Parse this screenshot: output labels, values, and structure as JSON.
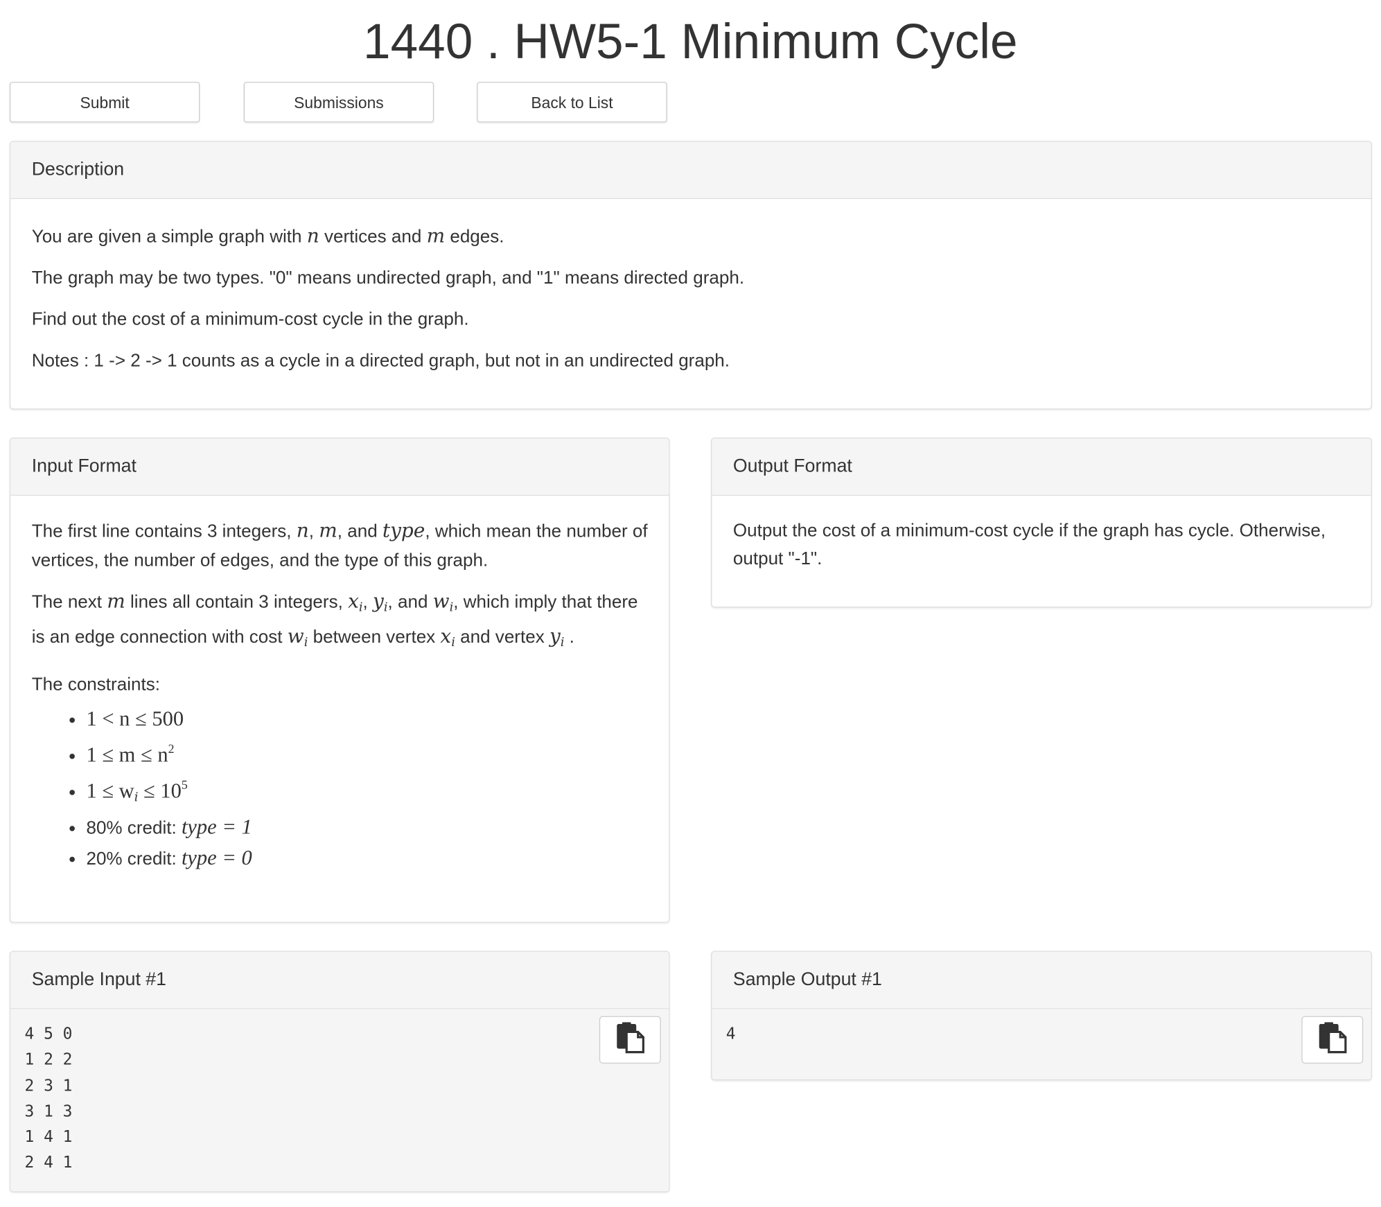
{
  "problem": {
    "title": "1440 . HW5-1 Minimum Cycle"
  },
  "toolbar": {
    "submit_label": "Submit",
    "submissions_label": "Submissions",
    "back_label": "Back to List"
  },
  "description": {
    "heading": "Description",
    "p1_a": "You are given a simple graph with ",
    "p1_n": "n",
    "p1_b": " vertices and ",
    "p1_m": "m",
    "p1_c": " edges.",
    "p2": "The graph may be two types. \"0\" means undirected graph, and \"1\" means directed graph.",
    "p3": "Find out the cost of a minimum-cost cycle in the graph.",
    "p4": "Notes : 1 -> 2 -> 1 counts as a cycle in a directed graph, but not in an undirected graph."
  },
  "input_format": {
    "heading": "Input Format",
    "p1_a": "The first line contains 3 integers, ",
    "p1_n": "n",
    "p1_sep1": ", ",
    "p1_m": "m",
    "p1_sep2": ", and ",
    "p1_type": "type",
    "p1_b": ", which mean the number of vertices, the number of edges, and the type of this graph.",
    "p2_a": "The next ",
    "p2_m": "m",
    "p2_b": " lines all contain 3 integers, ",
    "p2_x": "x",
    "p2_i1": "i",
    "p2_sep1": ", ",
    "p2_y": "y",
    "p2_i2": "i",
    "p2_sep2": ", and ",
    "p2_w": "w",
    "p2_i3": "i",
    "p2_c": ", which imply that there is an edge connection with cost ",
    "p2_w2": "w",
    "p2_i4": "i",
    "p2_d": " between vertex ",
    "p2_x2": "x",
    "p2_i5": "i",
    "p2_e": " and vertex ",
    "p2_y2": "y",
    "p2_i6": "i",
    "p2_f": " .",
    "constraints_label": "The constraints:",
    "c1": "1 < n ≤ 500",
    "c2_a": "1 ≤ m ≤ n",
    "c2_sup": "2",
    "c3_a": "1 ≤ w",
    "c3_sub": "i",
    "c3_b": " ≤ 10",
    "c3_sup": "5",
    "c4_label": "80% credit: ",
    "c4_math": "type = 1",
    "c5_label": "20% credit: ",
    "c5_math": "type = 0"
  },
  "output_format": {
    "heading": "Output Format",
    "text": "Output the cost of a minimum-cost cycle if the graph has cycle. Otherwise, output \"-1\"."
  },
  "sample_input": {
    "heading": "Sample Input #1",
    "content": "4 5 0\n1 2 2\n2 3 1\n3 1 3\n1 4 1\n2 4 1",
    "copy_icon": "copy-icon"
  },
  "sample_output": {
    "heading": "Sample Output #1",
    "content": "4",
    "copy_icon": "copy-icon"
  }
}
